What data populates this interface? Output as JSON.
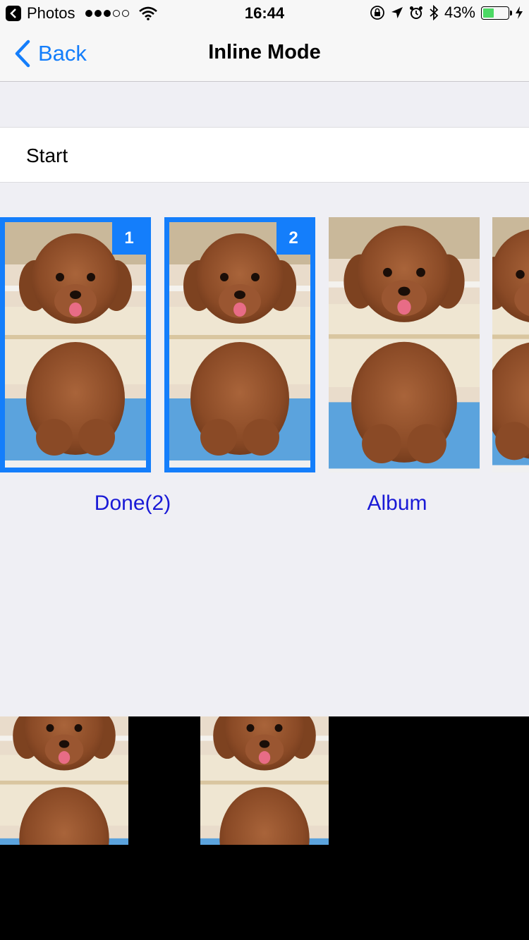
{
  "status_bar": {
    "app_back": "Photos",
    "time": "16:44",
    "battery": "43%",
    "battery_level": 0.43,
    "signal_dots": 3
  },
  "nav": {
    "back_label": "Back",
    "title": "Inline Mode"
  },
  "start_cell": {
    "label": "Start"
  },
  "photos": [
    {
      "selected": true,
      "badge": "1"
    },
    {
      "selected": true,
      "badge": "2"
    },
    {
      "selected": false,
      "badge": ""
    },
    {
      "selected": false,
      "badge": ""
    }
  ],
  "actions": {
    "done_label": "Done(2)",
    "album_label": "Album"
  },
  "colors": {
    "accent": "#147efb",
    "action_text": "#1a1ad6",
    "background": "#efeff4"
  }
}
